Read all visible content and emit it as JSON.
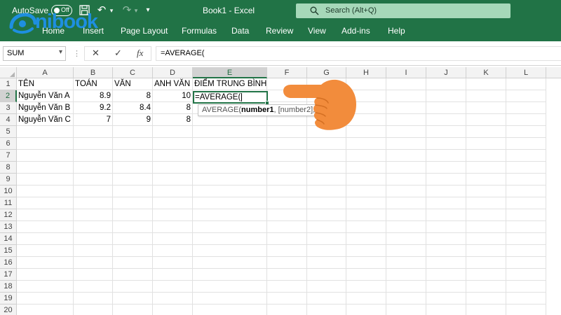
{
  "titlebar": {
    "autosave_label": "AutoSave",
    "toggle_state": "Off",
    "title": "Book1  -  Excel",
    "search_placeholder": "Search (Alt+Q)"
  },
  "ribbon": {
    "tabs": [
      "Home",
      "Insert",
      "Page Layout",
      "Formulas",
      "Data",
      "Review",
      "View",
      "Add-ins",
      "Help"
    ]
  },
  "watermark": {
    "text": "nibook"
  },
  "formula_bar": {
    "name_box": "SUM",
    "cancel_icon": "✕",
    "enter_icon": "✓",
    "fx_label": "fx",
    "formula": "=AVERAGE("
  },
  "grid": {
    "columns": [
      "A",
      "B",
      "C",
      "D",
      "E",
      "F",
      "G",
      "H",
      "I",
      "J",
      "K",
      "L"
    ],
    "rows": [
      "1",
      "2",
      "3",
      "4",
      "5",
      "6",
      "7",
      "8",
      "9",
      "10",
      "11",
      "12",
      "13",
      "14",
      "15",
      "16",
      "17",
      "18",
      "19",
      "20"
    ],
    "headers": {
      "a": "TÊN",
      "b": "TOÁN",
      "c": "VĂN",
      "d": "ANH VĂN",
      "e": "ĐIỂM TRUNG BÌNH"
    },
    "data_rows": [
      {
        "name": "Nguyễn Văn A",
        "toan": "8.9",
        "van": "8",
        "anh": "10"
      },
      {
        "name": "Nguyễn Văn B",
        "toan": "9.2",
        "van": "8.4",
        "anh": "8"
      },
      {
        "name": "Nguyễn Văn C",
        "toan": "7",
        "van": "9",
        "anh": "8"
      }
    ],
    "active_cell_text": "=AVERAGE(",
    "tooltip": {
      "fn": "AVERAGE(",
      "arg1": "number1",
      "rest": ", [number2], ..."
    }
  },
  "colors": {
    "excel_green": "#217346",
    "hand": "#f28c3c",
    "logo_blue": "#1e8fe0"
  }
}
